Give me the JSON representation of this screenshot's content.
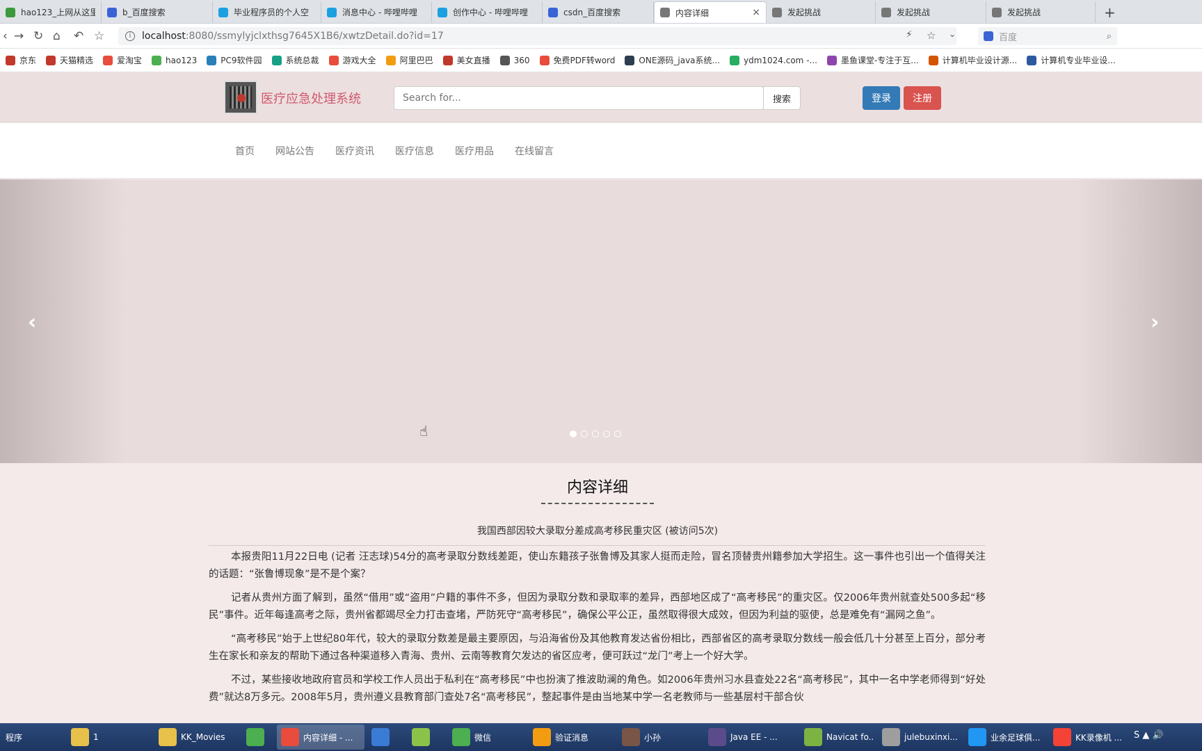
{
  "browser": {
    "tabs": [
      {
        "label": "hao123_上网从这里",
        "color": "#3c9a3c",
        "active": false
      },
      {
        "label": "b_百度搜索",
        "color": "#3a63d6",
        "active": false
      },
      {
        "label": "毕业程序员的个人空",
        "color": "#1ba0e1",
        "active": false
      },
      {
        "label": "消息中心 - 哔哩哔哩",
        "color": "#1ba0e1",
        "active": false
      },
      {
        "label": "创作中心 - 哔哩哔哩",
        "color": "#1ba0e1",
        "active": false
      },
      {
        "label": "csdn_百度搜索",
        "color": "#3a63d6",
        "active": false
      },
      {
        "label": "内容详细",
        "color": "#777777",
        "active": true
      },
      {
        "label": "发起挑战",
        "color": "#777777",
        "active": false
      },
      {
        "label": "发起挑战",
        "color": "#777777",
        "active": false
      },
      {
        "label": "发起挑战",
        "color": "#777777",
        "active": false
      }
    ],
    "new_tab": "+",
    "close_tab": "×",
    "url_host": "localhost",
    "url_rest": ":8080/ssmylyjclxthsg7645X1B6/xwtzDetail.do?id=17",
    "search_placeholder": "百度",
    "bookmarks": [
      {
        "label": "京东",
        "color": "#c0392b"
      },
      {
        "label": "天猫精选",
        "color": "#c0392b"
      },
      {
        "label": "爱淘宝",
        "color": "#e74c3c"
      },
      {
        "label": "hao123",
        "color": "#4caf50"
      },
      {
        "label": "PC9软件园",
        "color": "#2980b9"
      },
      {
        "label": "系统总裁",
        "color": "#16a085"
      },
      {
        "label": "游戏大全",
        "color": "#e74c3c"
      },
      {
        "label": "阿里巴巴",
        "color": "#f39c12"
      },
      {
        "label": "美女直播",
        "color": "#c0392b"
      },
      {
        "label": "360",
        "color": "#555555"
      },
      {
        "label": "免费PDF转word",
        "color": "#e74c3c"
      },
      {
        "label": "ONE源码_java系统...",
        "color": "#2c3e50"
      },
      {
        "label": "ydm1024.com -...",
        "color": "#27ae60"
      },
      {
        "label": "墨鱼课堂-专注于互...",
        "color": "#8e44ad"
      },
      {
        "label": "计算机毕业设计源...",
        "color": "#d35400"
      },
      {
        "label": "计算机专业毕业设...",
        "color": "#2c5aa0"
      }
    ]
  },
  "site": {
    "title": "医疗应急处理系统",
    "search_placeholder": "Search for...",
    "search_button": "搜索",
    "login_button": "登录",
    "register_button": "注册",
    "nav": [
      "首页",
      "网站公告",
      "医疗资讯",
      "医疗信息",
      "医疗用品",
      "在线留言"
    ],
    "carousel": {
      "prev": "‹",
      "next": "›",
      "slide_count": 5,
      "active_index": 0
    }
  },
  "content": {
    "heading": "内容详细",
    "article_title": "我国西部因较大录取分差成高考移民重灾区 (被访问5次)",
    "paragraphs": [
      "本报贵阳11月22日电 (记者 汪志球)54分的高考录取分数线差距，使山东籍孩子张鲁博及其家人挺而走险，冒名顶替贵州籍参加大学招生。这一事件也引出一个值得关注的话题：“张鲁博现象”是不是个案？",
      "记者从贵州方面了解到，虽然“借用”或“盗用”户籍的事件不多，但因为录取分数和录取率的差异，西部地区成了“高考移民”的重灾区。仅2006年贵州就查处500多起“移民”事件。近年每逢高考之际，贵州省都竭尽全力打击查堵，严防死守“高考移民”，确保公平公正，虽然取得很大成效，但因为利益的驱使，总是难免有“漏网之鱼”。",
      "“高考移民”始于上世纪80年代，较大的录取分数差是最主要原因，与沿海省份及其他教育发达省份相比，西部省区的高考录取分数线一般会低几十分甚至上百分，部分考生在家长和亲友的帮助下通过各种渠道移入青海、贵州、云南等教育欠发达的省区应考，便可跃过“龙门”考上一个好大学。",
      "不过，某些接收地政府官员和学校工作人员出于私利在“高考移民”中也扮演了推波助澜的角色。如2006年贵州习水县查处22名“高考移民”，其中一名中学老师得到“好处费”就达8万多元。2008年5月，贵州遵义县教育部门查处7名“高考移民”，整起事件是由当地某中学一名老教师与一些基层村干部合伙"
    ]
  },
  "taskbar": {
    "start": "程序",
    "items": [
      {
        "label": "1",
        "color": "#e8c14a"
      },
      {
        "label": "KK_Movies",
        "color": "#e8c14a"
      },
      {
        "label": "",
        "color": "#4caf50"
      },
      {
        "label": "内容详细 - ...",
        "color": "#e74c3c",
        "active": true
      },
      {
        "label": "",
        "color": "#3a7bd5"
      },
      {
        "label": "",
        "color": "#8bc34a"
      },
      {
        "label": "微信",
        "color": "#4caf50"
      },
      {
        "label": "验证消息",
        "color": "#f39c12"
      },
      {
        "label": "小孙",
        "color": "#795548"
      },
      {
        "label": "Java EE - ...",
        "color": "#5c4b8a"
      },
      {
        "label": "Navicat fo...",
        "color": "#7cb342"
      },
      {
        "label": "julebuxinxi...",
        "color": "#9e9e9e"
      },
      {
        "label": "业余足球俱...",
        "color": "#2196f3"
      },
      {
        "label": "KK录像机 ...",
        "color": "#f44336"
      }
    ],
    "tray": "S ▲ 🔊"
  }
}
